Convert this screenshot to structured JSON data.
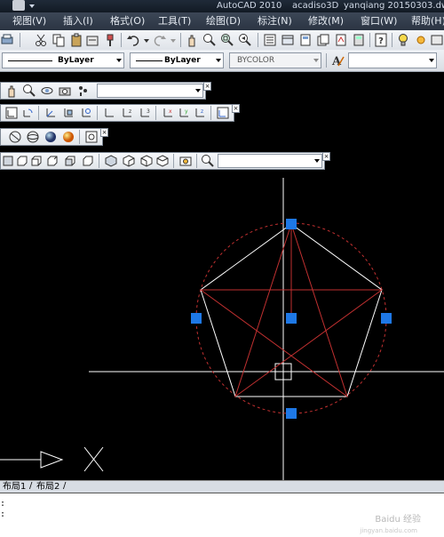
{
  "window": {
    "title_app": "AutoCAD 2010",
    "title_file": "acadiso3D",
    "title_doc": "yanqiang 20150303.dw"
  },
  "menu": {
    "items": [
      "视图(V)",
      "插入(I)",
      "格式(O)",
      "工具(T)",
      "绘图(D)",
      "标注(N)",
      "修改(M)",
      "窗口(W)",
      "帮助(H)"
    ]
  },
  "properties": {
    "linetype": "ByLayer",
    "lineweight": "ByLayer",
    "plotstyle": "BYCOLOR"
  },
  "layout_tabs": [
    "布局1",
    "布局2"
  ],
  "command_line": [
    ":",
    ":"
  ],
  "watermark": {
    "main": "Baidu 经验",
    "sub": "jingyan.baidu.com"
  },
  "colors": {
    "canvas": "#000000",
    "pentagon": "#ffffff",
    "star": "#c03030",
    "circle": "#c03030",
    "grip": "#1e78e6",
    "crosshair": "#ffffff"
  }
}
